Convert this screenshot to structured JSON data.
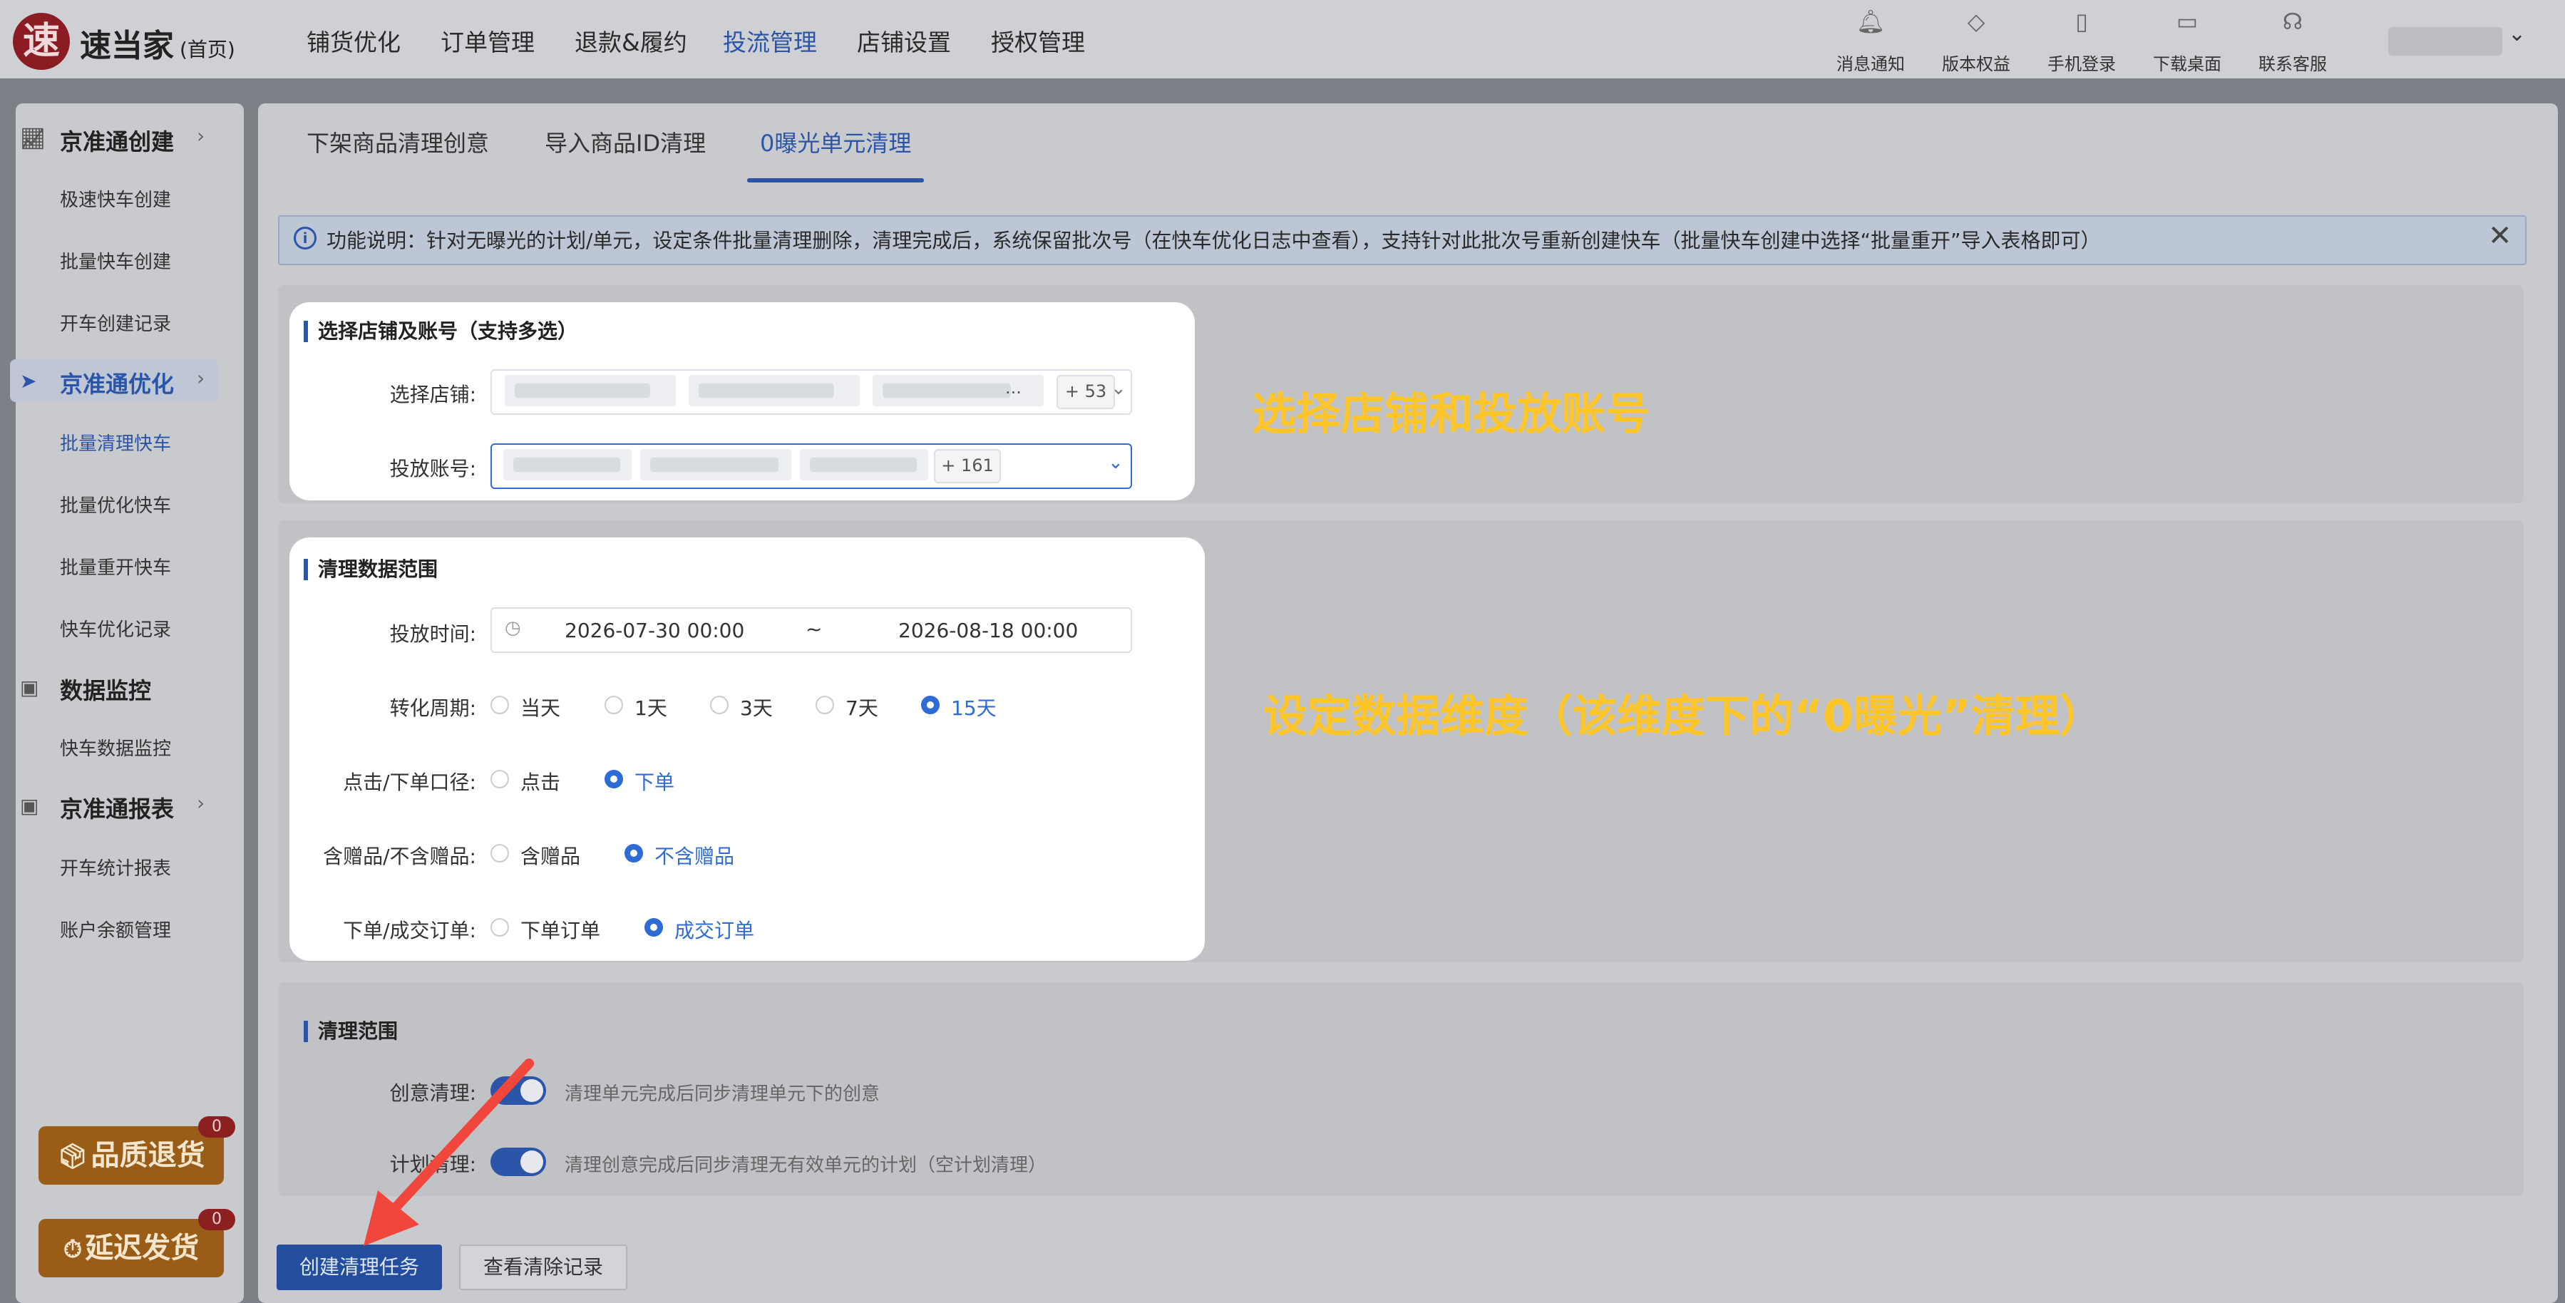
{
  "app": {
    "logo_char": "速",
    "name": "速当家",
    "home_label": "(首页)"
  },
  "top_nav": [
    "铺货优化",
    "订单管理",
    "退款&履约",
    "投流管理",
    "店铺设置",
    "授权管理"
  ],
  "top_nav_active": "投流管理",
  "top_tools": [
    {
      "label": "消息通知",
      "icon": "bell-icon"
    },
    {
      "label": "版本权益",
      "icon": "diamond-icon"
    },
    {
      "label": "手机登录",
      "icon": "phone-icon"
    },
    {
      "label": "下载桌面",
      "icon": "monitor-icon"
    },
    {
      "label": "联系客服",
      "icon": "headset-icon"
    }
  ],
  "sidebar": {
    "groups": [
      {
        "label": "京准通创建",
        "icon": "chart-icon",
        "items": [
          "极速快车创建",
          "批量快车创建",
          "开车创建记录"
        ]
      },
      {
        "label": "京准通优化",
        "icon": "send-icon",
        "items": [
          "批量清理快车",
          "批量优化快车",
          "批量重开快车",
          "快车优化记录"
        ]
      },
      {
        "label": "数据监控",
        "icon": "ad-icon",
        "items": [
          "快车数据监控"
        ]
      },
      {
        "label": "京准通报表",
        "icon": "ad-icon",
        "items": [
          "开车统计报表",
          "账户余额管理"
        ]
      }
    ],
    "active_group": "京准通优化",
    "active_item": "批量清理快车",
    "promos": [
      {
        "label": "品质退货",
        "count": "0",
        "icon": "box-icon"
      },
      {
        "label": "延迟发货",
        "count": "0",
        "icon": "clock-icon"
      }
    ]
  },
  "tabs": [
    "下架商品清理创意",
    "导入商品ID清理",
    "0曝光单元清理"
  ],
  "active_tab": "0曝光单元清理",
  "notice": "功能说明：针对无曝光的计划/单元，设定条件批量清理删除，清理完成后，系统保留批次号（在快车优化日志中查看），支持针对此批次号重新创建快车（批量快车创建中选择“批量重开”导入表格即可）",
  "section_shop": {
    "title": "选择店铺及账号（支持多选）",
    "shop_label": "选择店铺:",
    "shop_more": "+ 53",
    "shop_ellipsis": "...",
    "account_label": "投放账号:",
    "account_more": "+ 161"
  },
  "section_data": {
    "title": "清理数据范围",
    "time_label": "投放时间:",
    "start_date": "2026-07-30 00:00",
    "range_sep": "~",
    "end_date": "2026-08-18 00:00",
    "cycle_label": "转化周期:",
    "cycle_options": [
      "当天",
      "1天",
      "3天",
      "7天",
      "15天"
    ],
    "cycle_selected": "15天",
    "click_label": "点击/下单口径:",
    "click_options": [
      "点击",
      "下单"
    ],
    "click_selected": "下单",
    "gift_label": "含赠品/不含赠品:",
    "gift_options": [
      "含赠品",
      "不含赠品"
    ],
    "gift_selected": "不含赠品",
    "order_label": "下单/成交订单:",
    "order_options": [
      "下单订单",
      "成交订单"
    ],
    "order_selected": "成交订单"
  },
  "section_scope": {
    "title": "清理范围",
    "creative_label": "创意清理:",
    "creative_desc": "清理单元完成后同步清理单元下的创意",
    "creative_on": true,
    "plan_label": "计划清理:",
    "plan_desc": "清理创意完成后同步清理无有效单元的计划（空计划清理）",
    "plan_on": true
  },
  "annotations": {
    "shop": "选择店铺和投放账号",
    "data": "设定数据维度（该维度下的“0曝光”清理）"
  },
  "buttons": {
    "create": "创建清理任务",
    "records": "查看清除记录"
  },
  "colors": {
    "primary": "#2f6bd6",
    "annotation": "#ffc62a",
    "arrow": "#f0463c"
  }
}
